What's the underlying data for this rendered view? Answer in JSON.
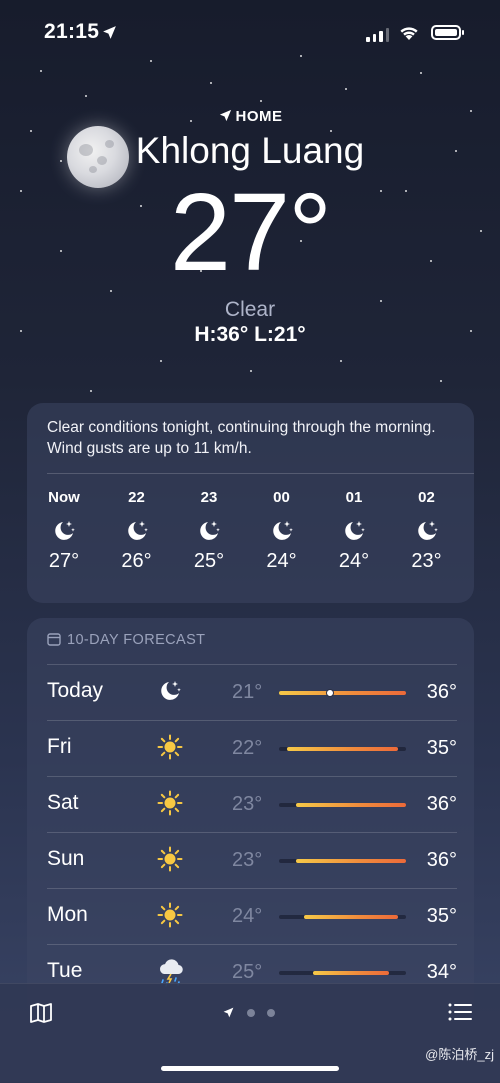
{
  "status": {
    "time": "21:15"
  },
  "header": {
    "home_label": "HOME",
    "city": "Khlong Luang",
    "temperature": "27°",
    "condition": "Clear",
    "hi_lo": "H:36°  L:21°"
  },
  "hourly_card": {
    "summary": "Clear conditions tonight, continuing through the morning. Wind gusts are up to 11 km/h.",
    "hours": [
      {
        "label": "Now",
        "icon": "moon-stars-icon",
        "temp": "27°"
      },
      {
        "label": "22",
        "icon": "moon-stars-icon",
        "temp": "26°"
      },
      {
        "label": "23",
        "icon": "moon-stars-icon",
        "temp": "25°"
      },
      {
        "label": "00",
        "icon": "moon-stars-icon",
        "temp": "24°"
      },
      {
        "label": "01",
        "icon": "moon-stars-icon",
        "temp": "24°"
      },
      {
        "label": "02",
        "icon": "moon-stars-icon",
        "temp": "23°"
      }
    ]
  },
  "forecast": {
    "title": "10-DAY FORECAST",
    "range_min": 21,
    "range_max": 36,
    "days": [
      {
        "day": "Today",
        "icon": "moon-stars-icon",
        "low": "21°",
        "high": "36°",
        "lo": 21,
        "hi": 36,
        "current": 27
      },
      {
        "day": "Fri",
        "icon": "sun-icon",
        "low": "22°",
        "high": "35°",
        "lo": 22,
        "hi": 35
      },
      {
        "day": "Sat",
        "icon": "sun-icon",
        "low": "23°",
        "high": "36°",
        "lo": 23,
        "hi": 36
      },
      {
        "day": "Sun",
        "icon": "sun-icon",
        "low": "23°",
        "high": "36°",
        "lo": 23,
        "hi": 36
      },
      {
        "day": "Mon",
        "icon": "sun-icon",
        "low": "24°",
        "high": "35°",
        "lo": 24,
        "hi": 35
      },
      {
        "day": "Tue",
        "icon": "thunderstorm-rain-icon",
        "low": "25°",
        "high": "34°",
        "lo": 25,
        "hi": 34
      }
    ]
  },
  "tabbar": {
    "page_count": 3,
    "active_page": 0
  },
  "watermark": "@陈泊桥_zj"
}
